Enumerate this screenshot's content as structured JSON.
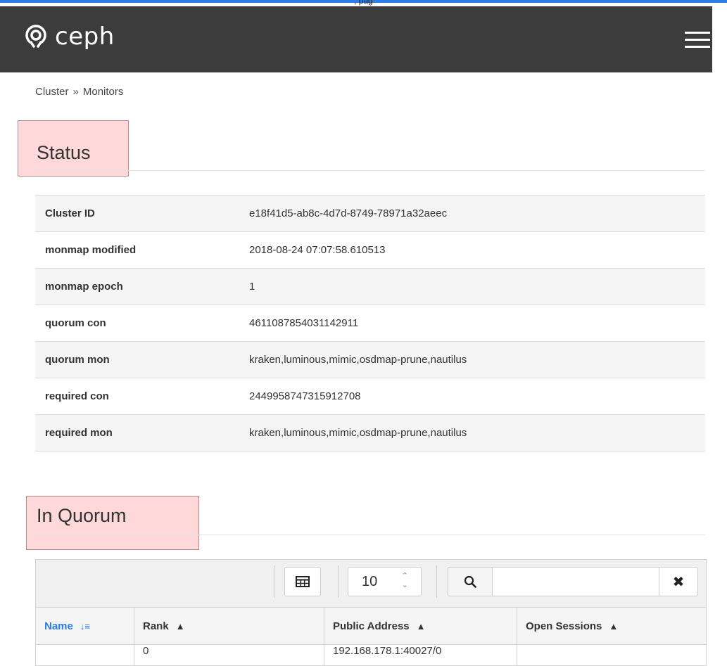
{
  "window": {
    "title": ", pag"
  },
  "header": {
    "brand": "ceph"
  },
  "breadcrumb": {
    "parent": "Cluster",
    "separator": "»",
    "current": "Monitors"
  },
  "status": {
    "title": "Status",
    "rows": [
      {
        "key": "Cluster ID",
        "value": "e18f41d5-ab8c-4d7d-8749-78971a32aeec"
      },
      {
        "key": "monmap modified",
        "value": "2018-08-24 07:07:58.610513"
      },
      {
        "key": "monmap epoch",
        "value": "1"
      },
      {
        "key": "quorum con",
        "value": "4611087854031142911"
      },
      {
        "key": "quorum mon",
        "value": "kraken,luminous,mimic,osdmap-prune,nautilus"
      },
      {
        "key": "required con",
        "value": "2449958747315912708"
      },
      {
        "key": "required mon",
        "value": "kraken,luminous,mimic,osdmap-prune,nautilus"
      }
    ]
  },
  "in_quorum": {
    "title": "In Quorum",
    "page_size": "10",
    "search": {
      "value": "",
      "placeholder": ""
    },
    "columns": [
      {
        "label": "Name"
      },
      {
        "label": "Rank"
      },
      {
        "label": "Public Address"
      },
      {
        "label": "Open Sessions"
      }
    ],
    "first_row": {
      "rank": "0",
      "public_address": "192.168.178.1:40027/0",
      "name": "",
      "open_sessions": ""
    }
  },
  "colors": {
    "navbar": "#3c3c3c",
    "accent": "#2b7de9",
    "highlight": "#ffaaaa"
  }
}
